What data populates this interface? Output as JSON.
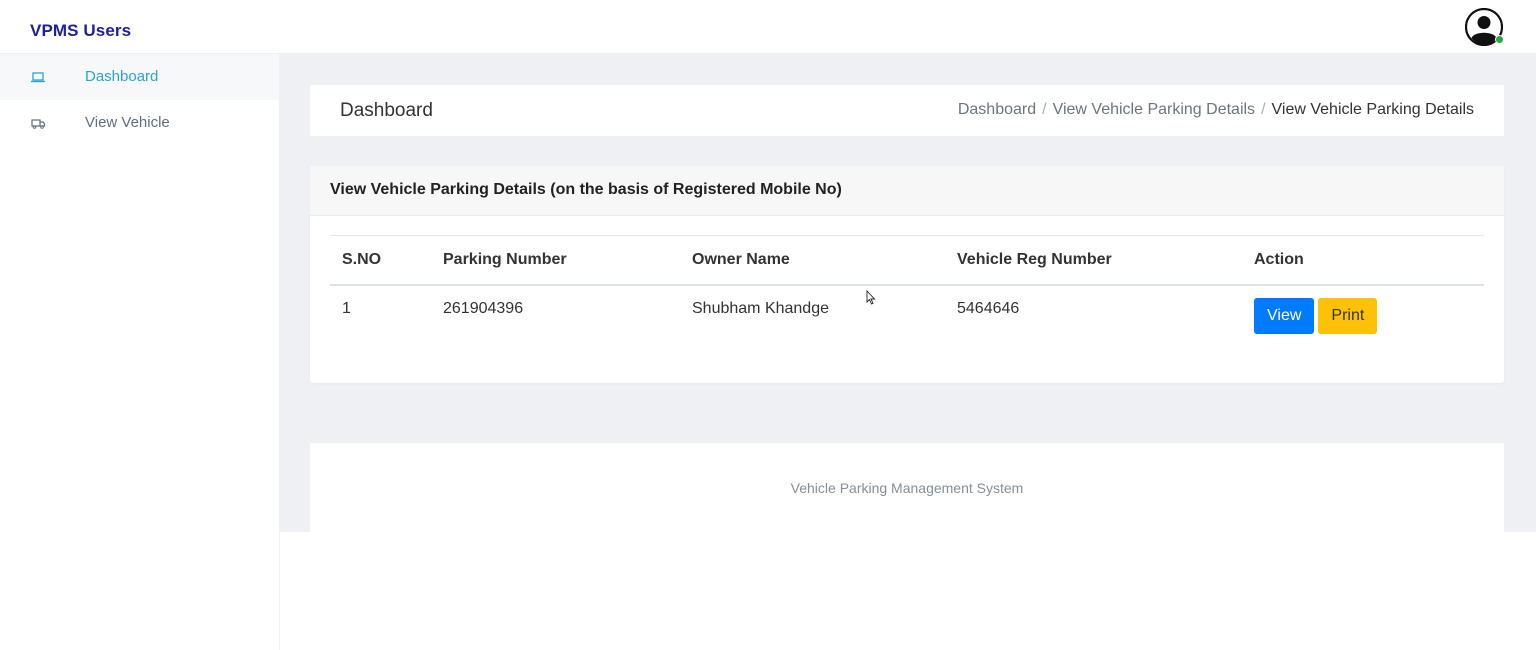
{
  "app": {
    "brand": "VPMS Users"
  },
  "sidebar": {
    "items": [
      {
        "label": "Dashboard",
        "icon": "laptop-icon",
        "active": true
      },
      {
        "label": "View Vehicle",
        "icon": "truck-icon",
        "active": false
      }
    ]
  },
  "page": {
    "title": "Dashboard",
    "breadcrumb": [
      "Dashboard",
      "View Vehicle Parking Details",
      "View Vehicle Parking Details"
    ],
    "breadcrumb_separator": "/"
  },
  "card": {
    "title": "View Vehicle Parking Details (on the basis of Registered Mobile No)",
    "columns": [
      "S.NO",
      "Parking Number",
      "Owner Name",
      "Vehicle Reg Number",
      "Action"
    ],
    "rows": [
      {
        "sno": "1",
        "parking_number": "261904396",
        "owner_name": "Shubham Khandge",
        "vehicle_reg": "5464646"
      }
    ],
    "view_label": "View",
    "print_label": "Print"
  },
  "footer": {
    "text": "Vehicle Parking Management System"
  },
  "colors": {
    "brand": "#1d1fa0",
    "sidebar_active": "#2ba3d6",
    "view_button": "#007bff",
    "print_button": "#ffc107",
    "online_status": "#28a745"
  }
}
